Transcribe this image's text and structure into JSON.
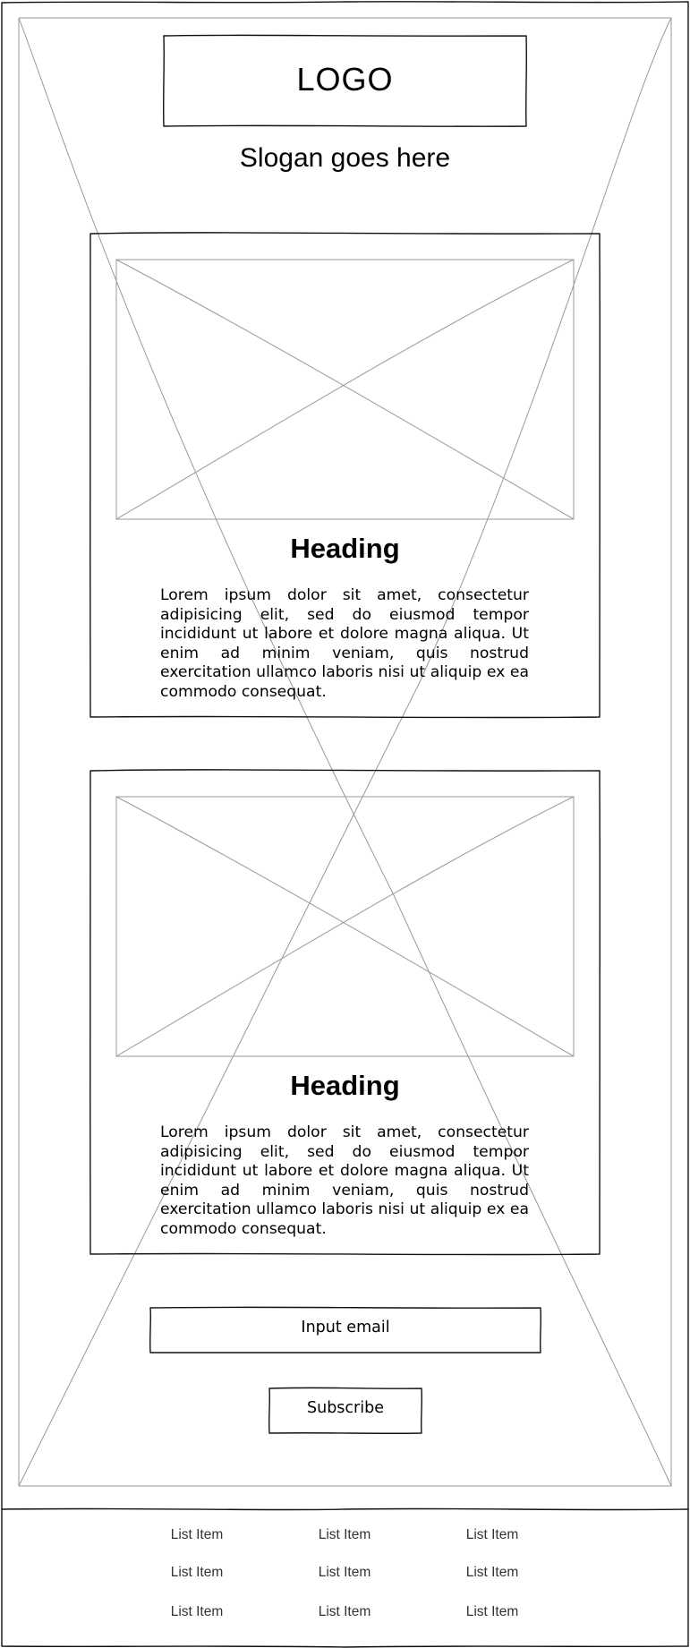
{
  "header": {
    "logo_text": "LOGO",
    "slogan": "Slogan goes here"
  },
  "cards": [
    {
      "heading": "Heading",
      "body": "Lorem ipsum dolor sit amet, consectetur adipisicing elit, sed do eiusmod tempor incididunt ut labore et dolore magna aliqua. Ut enim ad minim veniam, quis nostrud exercitation ullamco laboris nisi ut aliquip ex ea commodo consequat."
    },
    {
      "heading": "Heading",
      "body": "Lorem ipsum dolor sit amet, consectetur adipisicing elit, sed do eiusmod tempor incididunt ut labore et dolore magna aliqua. Ut enim ad minim veniam, quis nostrud exercitation ullamco laboris nisi ut aliquip ex ea commodo consequat."
    }
  ],
  "subscribe_form": {
    "email_placeholder": "Input email",
    "button_label": "Subscribe"
  },
  "footer": {
    "list_items": [
      [
        "List Item",
        "List Item",
        "List Item"
      ],
      [
        "List Item",
        "List Item",
        "List Item"
      ],
      [
        "List Item",
        "List Item",
        "List Item"
      ]
    ]
  },
  "colors": {
    "ink": "#000000",
    "placeholder_lines": "#999999",
    "background": "#ffffff"
  }
}
